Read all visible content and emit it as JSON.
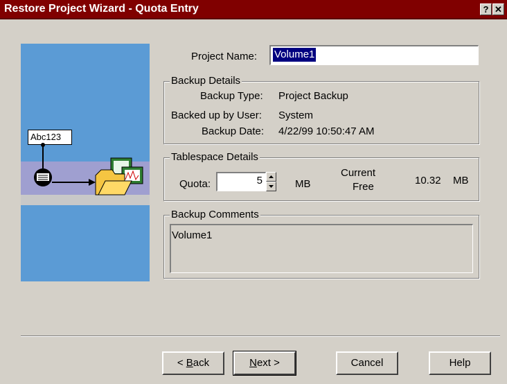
{
  "window": {
    "title": "Restore Project Wizard - Quota Entry",
    "help_glyph": "?",
    "close_glyph": "✕"
  },
  "graphic": {
    "label_text": "Abc123"
  },
  "project": {
    "label": "Project Name:",
    "value": "Volume1"
  },
  "backup_details": {
    "title": "Backup Details",
    "type_label": "Backup Type:",
    "type_value": "Project Backup",
    "user_label": "Backed up by User:",
    "user_value": "System",
    "date_label": "Backup Date:",
    "date_value": "4/22/99 10:50:47 AM"
  },
  "tablespace": {
    "title": "Tablespace Details",
    "quota_label": "Quota:",
    "quota_value": "5",
    "quota_unit": "MB",
    "current_free_label_1": "Current",
    "current_free_label_2": "Free",
    "current_free_value": "10.32",
    "current_free_unit": "MB"
  },
  "comments": {
    "title": "Backup Comments",
    "value": "Volume1"
  },
  "buttons": {
    "back_prefix": "< ",
    "back_mnemonic": "B",
    "back_rest": "ack",
    "next_mnemonic": "N",
    "next_rest": "ext >",
    "cancel": "Cancel",
    "help": "Help"
  },
  "colors": {
    "title_bar": "#800000",
    "graphic_bg": "#5b9bd5",
    "face": "#d4d0c8"
  }
}
